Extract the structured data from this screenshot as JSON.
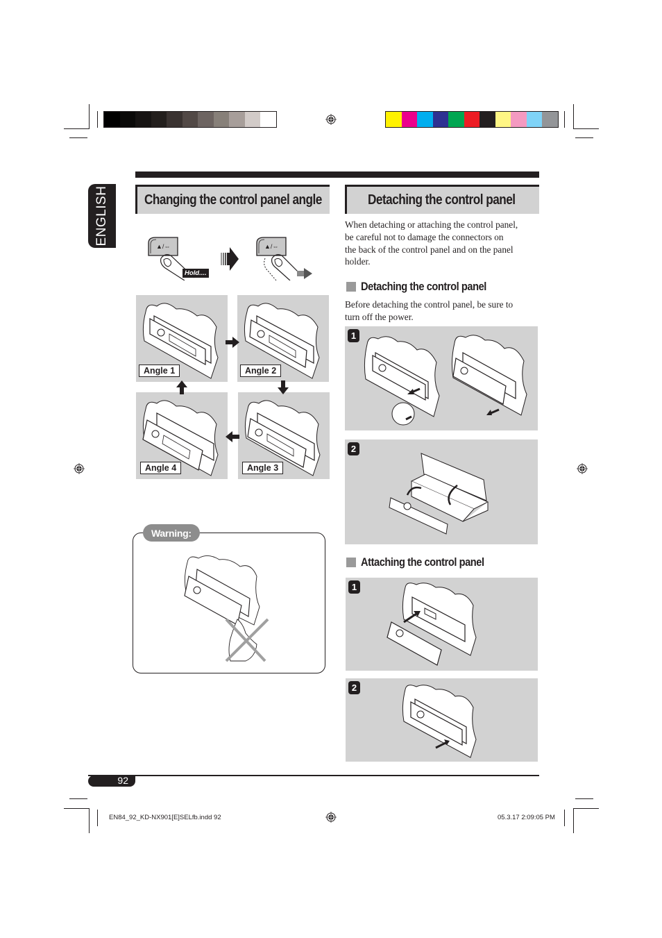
{
  "print_marks": {
    "grayscale_swatches": [
      "#000000",
      "#0b0a09",
      "#171413",
      "#231f1d",
      "#3a3331",
      "#524946",
      "#6d6461",
      "#878079",
      "#a79e9a",
      "#d2cbc8",
      "#ffffff"
    ],
    "color_swatches": [
      "#fff200",
      "#ec008c",
      "#00aeef",
      "#2e3192",
      "#00a651",
      "#ed1c24",
      "#231f20",
      "#fff685",
      "#f49ac1",
      "#7fd3f7",
      "#939598"
    ]
  },
  "language_tab": "ENGLISH",
  "left_section": {
    "title": "Changing the control panel angle",
    "hold_label": "Hold....",
    "button_glyph": "▲/⇔",
    "angles": [
      {
        "label": "Angle 1"
      },
      {
        "label": "Angle 2"
      },
      {
        "label": "Angle 3"
      },
      {
        "label": "Angle 4"
      }
    ],
    "warning_label": "Warning:"
  },
  "right_section": {
    "title": "Detaching the control panel",
    "intro": "When detaching or attaching the control panel, be careful not to damage the connectors on the back of the control panel and on the panel holder.",
    "intro_lines": [
      "When detaching or attaching the control panel,",
      "be careful not to damage the connectors on",
      "the back of the control panel and on the panel",
      "holder."
    ],
    "detach": {
      "heading": "Detaching the control panel",
      "text_lines": [
        "Before detaching the control panel, be sure to",
        "turn off the power."
      ],
      "steps": [
        {
          "number": "1"
        },
        {
          "number": "2"
        }
      ]
    },
    "attach": {
      "heading": "Attaching the control panel",
      "steps": [
        {
          "number": "1"
        },
        {
          "number": "2"
        }
      ]
    }
  },
  "footer": {
    "page_number": "92",
    "file_slug": "EN84_92_KD-NX901[E]SELfb.indd   92",
    "timestamp": "05.3.17   2:09:05 PM"
  }
}
